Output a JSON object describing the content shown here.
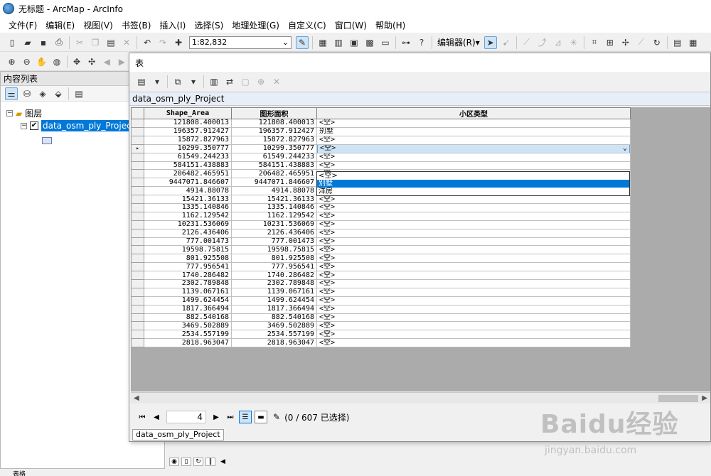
{
  "window": {
    "title": "无标题 - ArcMap - ArcInfo"
  },
  "menu": [
    "文件(F)",
    "编辑(E)",
    "视图(V)",
    "书签(B)",
    "插入(I)",
    "选择(S)",
    "地理处理(G)",
    "自定义(C)",
    "窗口(W)",
    "帮助(H)"
  ],
  "toolbar": {
    "scale": "1:82,832",
    "editor_label": "编辑器(R)"
  },
  "toc": {
    "header": "内容列表",
    "group_label": "图层",
    "layer_label": "data_osm_ply_Project"
  },
  "table_window": {
    "title": "表",
    "table_name": "data_osm_ply_Project",
    "columns": [
      "Shape_Area",
      "图形面积",
      "小区类型"
    ],
    "rows": [
      [
        "121808.400013",
        "121808.400013",
        "<空>"
      ],
      [
        "196357.912427",
        "196357.912427",
        "别墅"
      ],
      [
        "15872.827963",
        "15872.827963",
        "<空>"
      ],
      [
        "10299.350777",
        "10299.350777",
        "<空>"
      ],
      [
        "61549.244233",
        "61549.244233",
        "<空>"
      ],
      [
        "584151.438883",
        "584151.438883",
        "<空>"
      ],
      [
        "206482.465951",
        "206482.465951",
        "<空>"
      ],
      [
        "9447071.846607",
        "9447071.846607",
        "<空>"
      ],
      [
        "4914.88078",
        "4914.88078",
        "<空>"
      ],
      [
        "15421.36133",
        "15421.36133",
        "<空>"
      ],
      [
        "1335.140846",
        "1335.140846",
        "<空>"
      ],
      [
        "1162.129542",
        "1162.129542",
        "<空>"
      ],
      [
        "10231.536069",
        "10231.536069",
        "<空>"
      ],
      [
        "2126.436406",
        "2126.436406",
        "<空>"
      ],
      [
        "777.001473",
        "777.001473",
        "<空>"
      ],
      [
        "19598.75815",
        "19598.75815",
        "<空>"
      ],
      [
        "801.925508",
        "801.925508",
        "<空>"
      ],
      [
        "777.956541",
        "777.956541",
        "<空>"
      ],
      [
        "1740.286482",
        "1740.286482",
        "<空>"
      ],
      [
        "2302.789848",
        "2302.789848",
        "<空>"
      ],
      [
        "1139.067161",
        "1139.067161",
        "<空>"
      ],
      [
        "1499.624454",
        "1499.624454",
        "<空>"
      ],
      [
        "1817.366494",
        "1817.366494",
        "<空>"
      ],
      [
        "882.540168",
        "882.540168",
        "<空>"
      ],
      [
        "3469.502889",
        "3469.502889",
        "<空>"
      ],
      [
        "2534.557199",
        "2534.557199",
        "<空>"
      ],
      [
        "2818.963047",
        "2818.963047",
        "<空>"
      ]
    ],
    "dropdown_options": [
      "<空>",
      "别墅",
      "洋房"
    ],
    "dropdown_selected": "别墅",
    "current_row_value": "<空>",
    "current_page": "4",
    "selection_status": "(0 / 607 已选择)",
    "tab_label": "data_osm_ply_Project"
  },
  "status_tab": "表格",
  "watermark": {
    "brand": "Baidu经验",
    "url": "jingyan.baidu.com"
  }
}
